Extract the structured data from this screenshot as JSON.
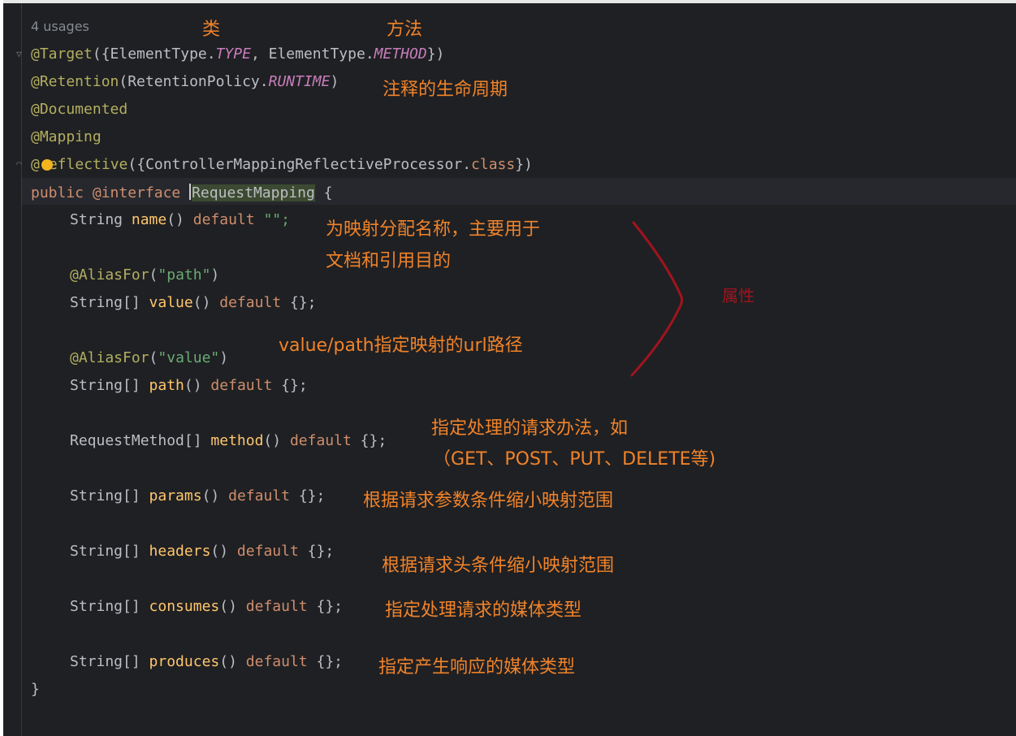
{
  "usages": "4 usages",
  "code": {
    "target_prefix": "@Target",
    "target_open": "({ElementType.",
    "target_type": "TYPE",
    "target_mid": ", ElementType.",
    "target_method": "METHOD",
    "target_close": "})",
    "retention": "@Retention",
    "retention_open": "(RetentionPolicy.",
    "retention_runtime": "RUNTIME",
    "retention_close": ")",
    "documented": "@Documented",
    "mapping": "@Mapping",
    "reflective_at": "@",
    "reflective_rest": "eflective",
    "reflective_args": "({ControllerMappingReflectiveProcessor.",
    "reflective_class": "class",
    "reflective_close": "})",
    "decl_public": "public",
    "decl_interface": "@interface",
    "decl_name": "RequestMapping",
    "decl_brace": "{",
    "name_type": "String ",
    "name_fn": "name",
    "name_parens": "()",
    "name_default": " default ",
    "name_value": "\"\";",
    "alias1_ann": "@AliasFor",
    "alias1_open": "(",
    "alias1_str": "\"path\"",
    "alias1_close": ")",
    "value_type": "String[] ",
    "value_fn": "value",
    "value_parens": "()",
    "value_default": " default ",
    "value_val": "{};",
    "alias2_ann": "@AliasFor",
    "alias2_open": "(",
    "alias2_str": "\"value\"",
    "alias2_close": ")",
    "path_type": "String[] ",
    "path_fn": "path",
    "path_parens": "()",
    "path_default": " default ",
    "path_val": "{};",
    "method_type": "RequestMethod[] ",
    "method_fn": "method",
    "method_parens": "()",
    "method_default": " default ",
    "method_val": "{};",
    "params_type": "String[] ",
    "params_fn": "params",
    "params_parens": "()",
    "params_default": " default ",
    "params_val": "{};",
    "headers_type": "String[] ",
    "headers_fn": "headers",
    "headers_parens": "()",
    "headers_default": " default ",
    "headers_val": "{};",
    "consumes_type": "String[] ",
    "consumes_fn": "consumes",
    "consumes_parens": "()",
    "consumes_default": " default ",
    "consumes_val": "{};",
    "produces_type": "String[] ",
    "produces_fn": "produces",
    "produces_parens": "()",
    "produces_default": " default ",
    "produces_val": "{};",
    "closing_brace": "}"
  },
  "notes": {
    "class_label": "类",
    "method_label": "方法",
    "retention_note": "注释的生命周期",
    "name_note_1": "为映射分配名称，主要用于",
    "name_note_2": "文档和引用目的",
    "attributes_label": "属性",
    "value_path_note": "value/path指定映射的url路径",
    "method_note_1": "指定处理的请求办法，如",
    "method_note_2": "（GET、POST、PUT、DELETE等)",
    "params_note": "根据请求参数条件缩小映射范围",
    "headers_note": "根据请求头条件缩小映射范围",
    "consumes_note": "指定处理请求的媒体类型",
    "produces_note": "指定产生响应的媒体类型"
  },
  "colors": {
    "editor_bg": "#1f2023",
    "annotation_text": "#f0832a",
    "brace_red": "#a0141e"
  }
}
